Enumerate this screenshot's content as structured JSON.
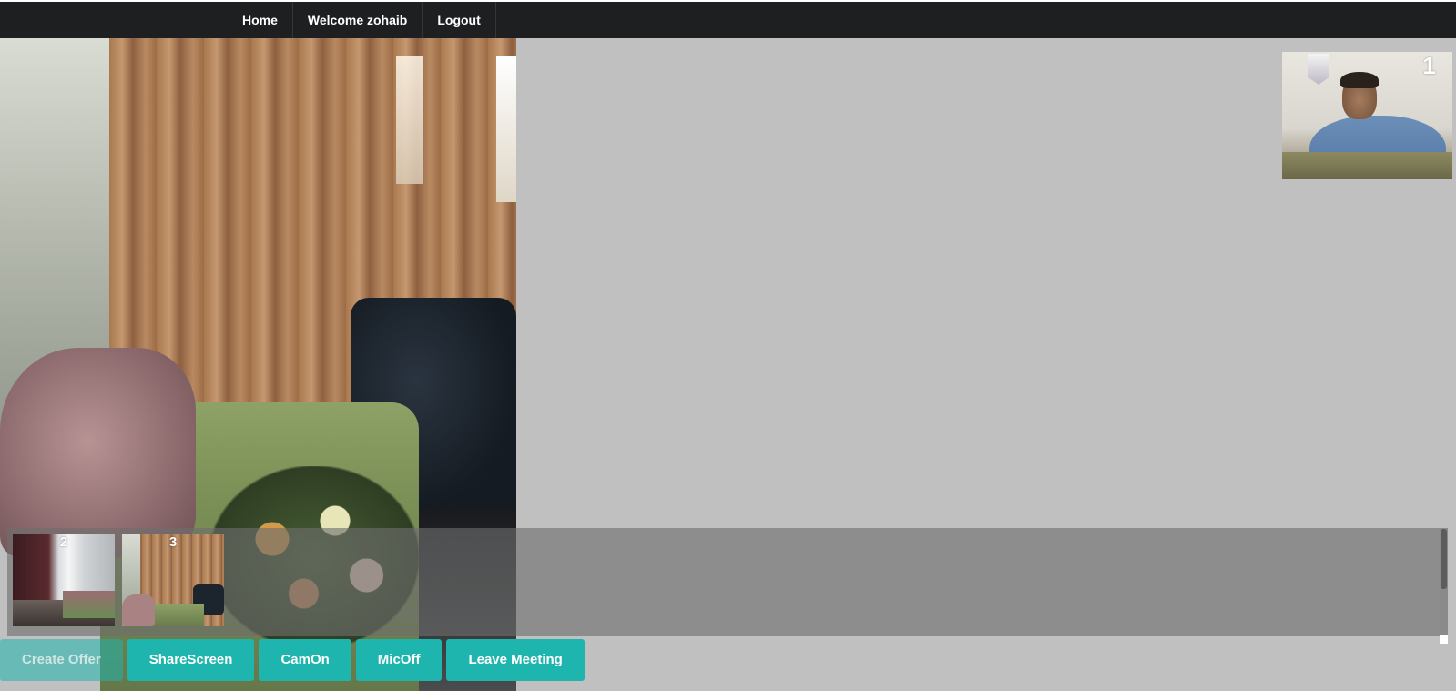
{
  "navbar": {
    "items": [
      {
        "label": "Home"
      },
      {
        "label": "Welcome zohaib"
      },
      {
        "label": "Logout"
      }
    ]
  },
  "remote_video": {
    "tile_number": "1"
  },
  "thumbnails": [
    {
      "tile_number": "2"
    },
    {
      "tile_number": "3"
    }
  ],
  "controls": {
    "create_offer": "Create Offer",
    "share_screen": "ShareScreen",
    "cam_on": "CamOn",
    "mic_off": "MicOff",
    "leave_meeting": "Leave Meeting"
  },
  "colors": {
    "navbar_bg": "#1d1f21",
    "page_bg": "#c0c0c0",
    "button_accent": "#1db5ad"
  }
}
